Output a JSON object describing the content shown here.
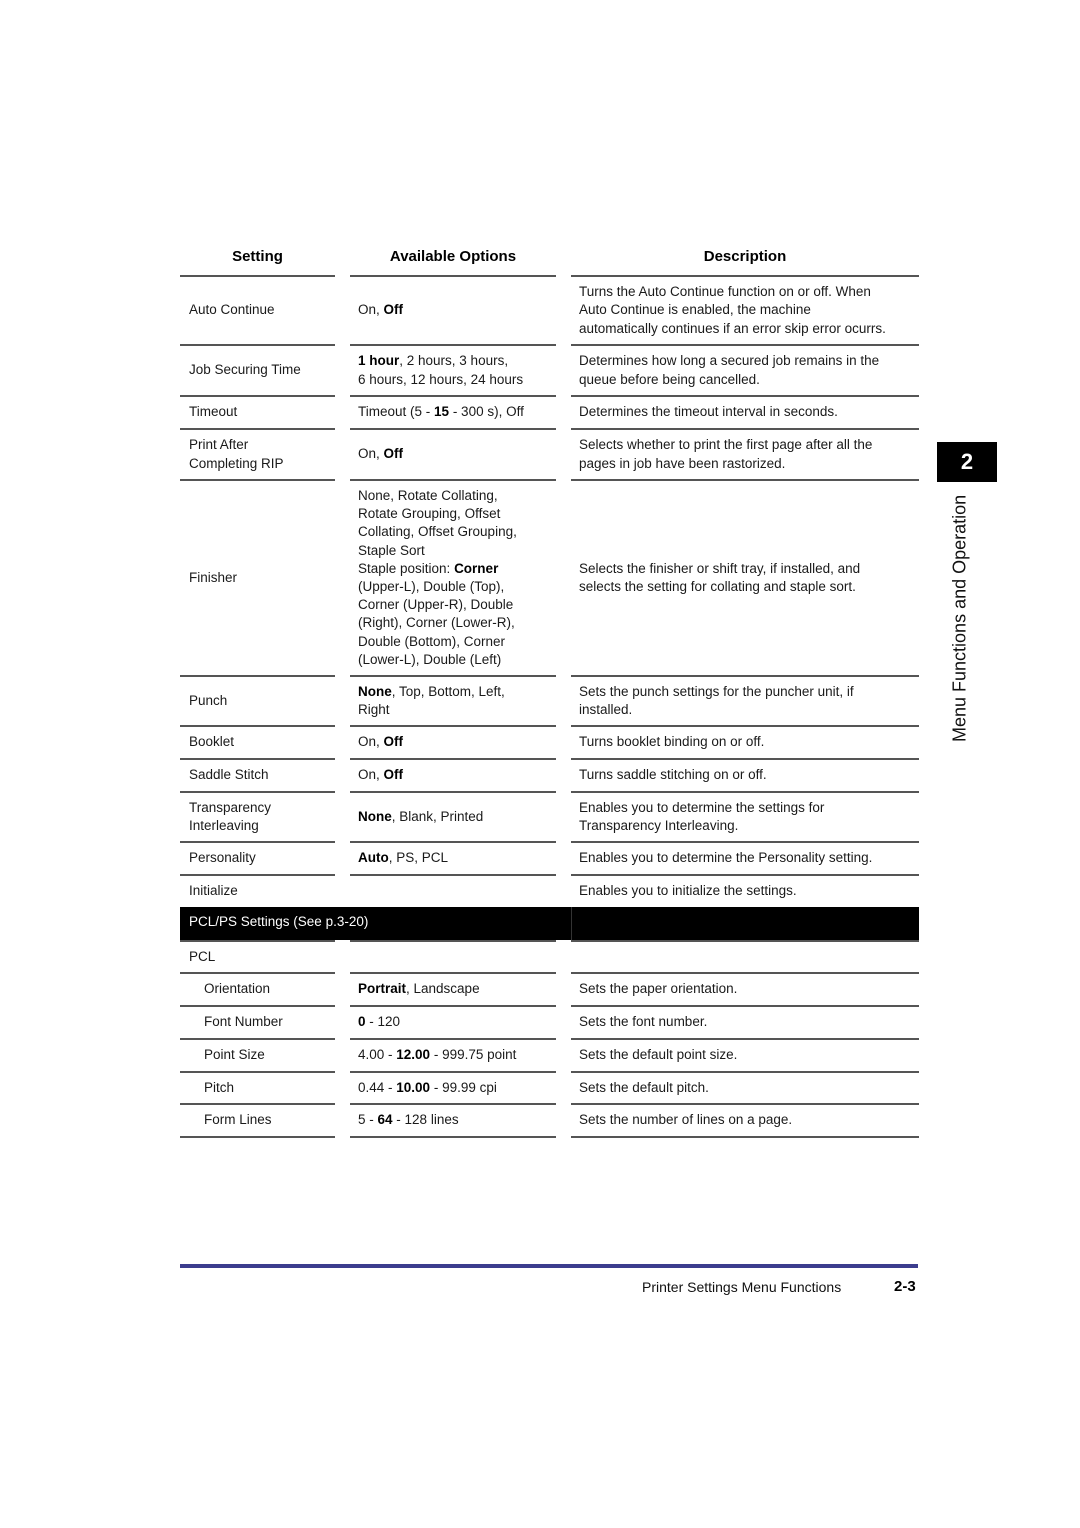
{
  "table": {
    "headers": {
      "setting": "Setting",
      "options": "Available Options",
      "description": "Description"
    },
    "rows": [
      {
        "setting": [
          "Auto Continue"
        ],
        "options": [
          [
            {
              "t": "On, "
            },
            {
              "t": "Off",
              "b": true
            }
          ]
        ],
        "description": [
          "Turns the Auto Continue function on or off.  When",
          "Auto Continue is enabled, the machine",
          "automatically continues if an error skip error ocurrs."
        ]
      },
      {
        "setting": [
          "Job Securing Time"
        ],
        "options": [
          [
            {
              "t": "1 hour",
              "b": true
            },
            {
              "t": ", 2 hours, 3 hours,"
            }
          ],
          [
            {
              "t": "6 hours, 12 hours, 24 hours"
            }
          ]
        ],
        "description": [
          "Determines how long a secured job remains in the",
          "queue before being cancelled."
        ]
      },
      {
        "setting": [
          "Timeout"
        ],
        "options": [
          [
            {
              "t": "Timeout (5 - "
            },
            {
              "t": "15",
              "b": true
            },
            {
              "t": " - 300 s), Off"
            }
          ]
        ],
        "description": [
          "Determines the timeout interval in seconds."
        ]
      },
      {
        "setting": [
          "Print After",
          "Completing RIP"
        ],
        "options": [
          [
            {
              "t": "On, "
            },
            {
              "t": "Off",
              "b": true
            }
          ]
        ],
        "description": [
          "Selects whether to print the first page after all  the",
          "pages in job have been rastorized."
        ]
      },
      {
        "setting": [
          "Finisher"
        ],
        "options": [
          [
            {
              "t": "None, Rotate Collating,"
            }
          ],
          [
            {
              "t": "Rotate Grouping, Offset"
            }
          ],
          [
            {
              "t": "Collating, Offset Grouping,"
            }
          ],
          [
            {
              "t": "Staple Sort"
            }
          ],
          [
            {
              "t": "Staple position: "
            },
            {
              "t": "Corner",
              "b": true
            }
          ],
          [
            {
              "t": "(Upper-L), Double (Top),"
            }
          ],
          [
            {
              "t": "Corner (Upper-R), Double"
            }
          ],
          [
            {
              "t": "(Right), Corner (Lower-R),"
            }
          ],
          [
            {
              "t": "Double (Bottom), Corner"
            }
          ],
          [
            {
              "t": "(Lower-L), Double (Left)"
            }
          ]
        ],
        "description": [
          "Selects the finisher or shift tray, if installed, and",
          "selects the setting for collating and staple sort."
        ]
      },
      {
        "setting": [
          "Punch"
        ],
        "options": [
          [
            {
              "t": "None",
              "b": true
            },
            {
              "t": ", Top, Bottom, Left,"
            }
          ],
          [
            {
              "t": "Right"
            }
          ]
        ],
        "description": [
          "Sets the punch settings for the puncher unit, if",
          "installed."
        ]
      },
      {
        "setting": [
          "Booklet"
        ],
        "options": [
          [
            {
              "t": "On, "
            },
            {
              "t": "Off",
              "b": true
            }
          ]
        ],
        "description": [
          "Turns booklet binding on or off."
        ]
      },
      {
        "setting": [
          "Saddle Stitch"
        ],
        "options": [
          [
            {
              "t": "On, "
            },
            {
              "t": "Off",
              "b": true
            }
          ]
        ],
        "description": [
          "Turns saddle stitching on or off."
        ]
      },
      {
        "setting": [
          "Transparency",
          "Interleaving"
        ],
        "options": [
          [
            {
              "t": "None",
              "b": true
            },
            {
              "t": ", Blank, Printed"
            }
          ]
        ],
        "description": [
          "Enables you to determine the settings for",
          "Transparency Interleaving."
        ]
      },
      {
        "setting": [
          "Personality"
        ],
        "options": [
          [
            {
              "t": "Auto",
              "b": true
            },
            {
              "t": ", PS, PCL"
            }
          ]
        ],
        "description": [
          "Enables you to determine the Personality setting."
        ]
      },
      {
        "setting": [
          "Initialize"
        ],
        "options": [],
        "description": [
          "Enables you to initialize the settings."
        ]
      }
    ],
    "section_band": "PCL/PS Settings (See p.3-20)",
    "sub_rows": [
      {
        "setting": [
          "PCL"
        ],
        "indent": false,
        "options": [],
        "description": []
      },
      {
        "setting": [
          "Orientation"
        ],
        "indent": true,
        "options": [
          [
            {
              "t": "Portrait",
              "b": true
            },
            {
              "t": ", Landscape"
            }
          ]
        ],
        "description": [
          "Sets the paper orientation."
        ]
      },
      {
        "setting": [
          "Font Number"
        ],
        "indent": true,
        "options": [
          [
            {
              "t": "0",
              "b": true
            },
            {
              "t": " - 120"
            }
          ]
        ],
        "description": [
          "Sets the font number."
        ]
      },
      {
        "setting": [
          "Point Size"
        ],
        "indent": true,
        "options": [
          [
            {
              "t": "4.00 - "
            },
            {
              "t": "12.00",
              "b": true
            },
            {
              "t": " - 999.75 point"
            }
          ]
        ],
        "description": [
          "Sets the default point size."
        ]
      },
      {
        "setting": [
          "Pitch"
        ],
        "indent": true,
        "options": [
          [
            {
              "t": "0.44 - "
            },
            {
              "t": "10.00",
              "b": true
            },
            {
              "t": " - 99.99 cpi"
            }
          ]
        ],
        "description": [
          "Sets the default pitch."
        ]
      },
      {
        "setting": [
          "Form Lines"
        ],
        "indent": true,
        "options": [
          [
            {
              "t": "5 - "
            },
            {
              "t": "64",
              "b": true
            },
            {
              "t": " - 128 lines"
            }
          ]
        ],
        "description": [
          "Sets the number of lines on a page."
        ]
      }
    ]
  },
  "side_tab": {
    "chapter_number": "2",
    "chapter_title": "Menu Functions and Operation"
  },
  "footer": {
    "section_title": "Printer Settings Menu Functions",
    "page_number": "2-3",
    "bar_color": "#3c3d8e"
  }
}
